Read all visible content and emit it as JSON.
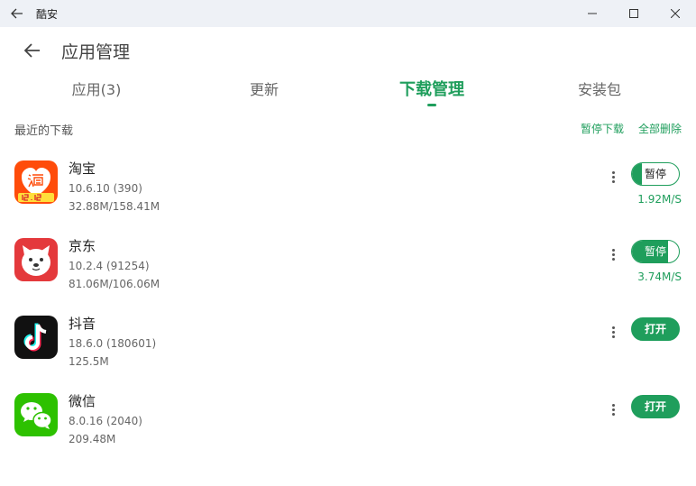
{
  "window": {
    "title": "酷安"
  },
  "header": {
    "title": "应用管理"
  },
  "tabs": [
    {
      "label": "应用(3)",
      "active": false
    },
    {
      "label": "更新",
      "active": false
    },
    {
      "label": "下载管理",
      "active": true
    },
    {
      "label": "安装包",
      "active": false
    }
  ],
  "section": {
    "title": "最近的下载",
    "pause_all": "暂停下载",
    "delete_all": "全部删除"
  },
  "apps": [
    {
      "name": "淘宝",
      "version": "10.6.10 (390)",
      "size": "32.88M/158.41M",
      "action": "暂停",
      "speed": "1.92M/S",
      "progress": 0.21,
      "icon": "taobao-icon"
    },
    {
      "name": "京东",
      "version": "10.2.4 (91254)",
      "size": "81.06M/106.06M",
      "action": "暂停",
      "speed": "3.74M/S",
      "progress": 0.76,
      "icon": "jd-icon"
    },
    {
      "name": "抖音",
      "version": "18.6.0 (180601)",
      "size": "125.5M",
      "action": "打开",
      "icon": "douyin-icon"
    },
    {
      "name": "微信",
      "version": "8.0.16 (2040)",
      "size": "209.48M",
      "action": "打开",
      "icon": "wechat-icon"
    }
  ],
  "colors": {
    "accent": "#1f9e5c",
    "titlebar": "#eef1f6"
  }
}
